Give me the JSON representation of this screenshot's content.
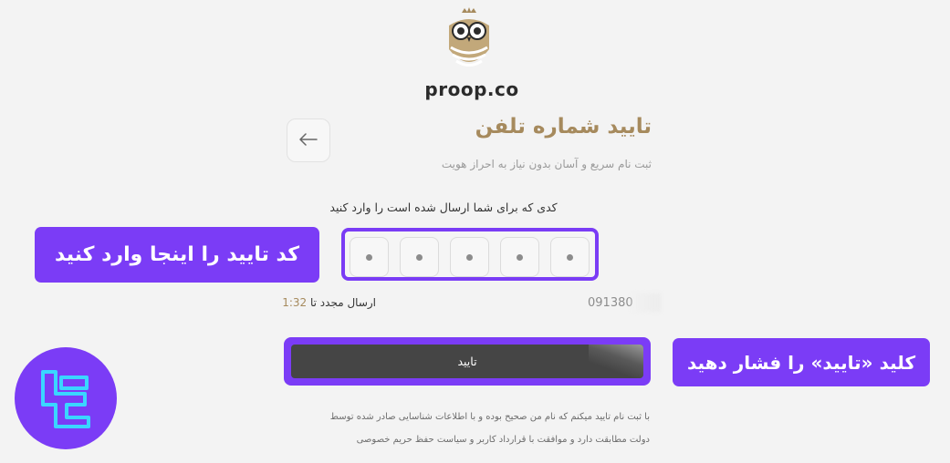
{
  "brand": {
    "logo_text": "proop.co"
  },
  "header": {
    "title": "تایید شماره تلفن",
    "subtitle": "ثبت نام سریع و آسان بدون نیاز به احراز هویت"
  },
  "verification": {
    "prompt": "کدی که برای شما ارسال شده است را وارد کنید",
    "code_digits": [
      "",
      "",
      "",
      "",
      ""
    ],
    "phone_number": "091380",
    "resend_label": "ارسال مجدد تا",
    "resend_timer": "1:32"
  },
  "actions": {
    "confirm_label": "تایید"
  },
  "terms": {
    "line1": "با ثبت نام تایید میکنم که نام من صحیح بوده و با اطلاعات شناسایی صادر شده توسط",
    "line2": "دولت مطابقت دارد و موافقت با قرارداد کاربر و سیاست حفظ حریم خصوصی"
  },
  "annotations": {
    "enter_code": "کد تایید را اینجا وارد کنید",
    "press_confirm": "کلید «تایید» را فشار دهید"
  },
  "colors": {
    "accent": "#7b3cf6",
    "gold": "#a68a5d",
    "button": "#454545"
  }
}
